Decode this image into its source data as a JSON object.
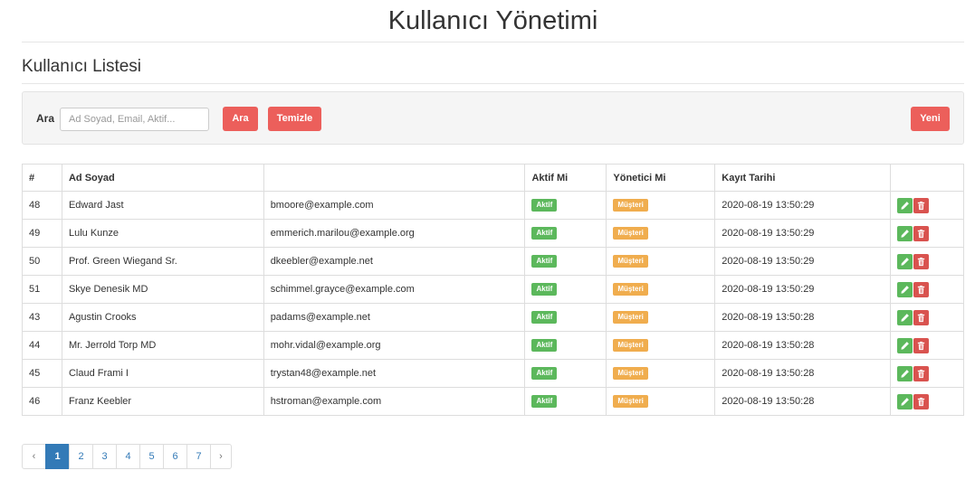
{
  "page": {
    "title": "Kullanıcı Yönetimi"
  },
  "section": {
    "title": "Kullanıcı Listesi"
  },
  "search": {
    "label": "Ara",
    "placeholder": "Ad Soyad, Email, Aktif...",
    "value": "",
    "search_button": "Ara",
    "clear_button": "Temizle",
    "new_button": "Yeni"
  },
  "table": {
    "headers": [
      "#",
      "Ad Soyad",
      "",
      "Aktif Mi",
      "Yönetici Mi",
      "Kayıt Tarihi",
      ""
    ],
    "rows": [
      {
        "id": "48",
        "name": "Edward Jast",
        "email": "bmoore@example.com",
        "active": "Aktif",
        "role": "Müşteri",
        "date": "2020-08-19 13:50:29"
      },
      {
        "id": "49",
        "name": "Lulu Kunze",
        "email": "emmerich.marilou@example.org",
        "active": "Aktif",
        "role": "Müşteri",
        "date": "2020-08-19 13:50:29"
      },
      {
        "id": "50",
        "name": "Prof. Green Wiegand Sr.",
        "email": "dkeebler@example.net",
        "active": "Aktif",
        "role": "Müşteri",
        "date": "2020-08-19 13:50:29"
      },
      {
        "id": "51",
        "name": "Skye Denesik MD",
        "email": "schimmel.grayce@example.com",
        "active": "Aktif",
        "role": "Müşteri",
        "date": "2020-08-19 13:50:29"
      },
      {
        "id": "43",
        "name": "Agustin Crooks",
        "email": "padams@example.net",
        "active": "Aktif",
        "role": "Müşteri",
        "date": "2020-08-19 13:50:28"
      },
      {
        "id": "44",
        "name": "Mr. Jerrold Torp MD",
        "email": "mohr.vidal@example.org",
        "active": "Aktif",
        "role": "Müşteri",
        "date": "2020-08-19 13:50:28"
      },
      {
        "id": "45",
        "name": "Claud Frami I",
        "email": "trystan48@example.net",
        "active": "Aktif",
        "role": "Müşteri",
        "date": "2020-08-19 13:50:28"
      },
      {
        "id": "46",
        "name": "Franz Keebler",
        "email": "hstroman@example.com",
        "active": "Aktif",
        "role": "Müşteri",
        "date": "2020-08-19 13:50:28"
      }
    ],
    "actions": {
      "edit_icon": "pencil-icon",
      "delete_icon": "trash-icon"
    }
  },
  "pagination": {
    "prev": "‹",
    "next": "›",
    "pages": [
      "1",
      "2",
      "3",
      "4",
      "5",
      "6",
      "7"
    ],
    "current": "1"
  },
  "colors": {
    "danger": "#ec5f5b",
    "success": "#5cb85c",
    "warning": "#f0ad4e",
    "primary": "#337ab7"
  }
}
